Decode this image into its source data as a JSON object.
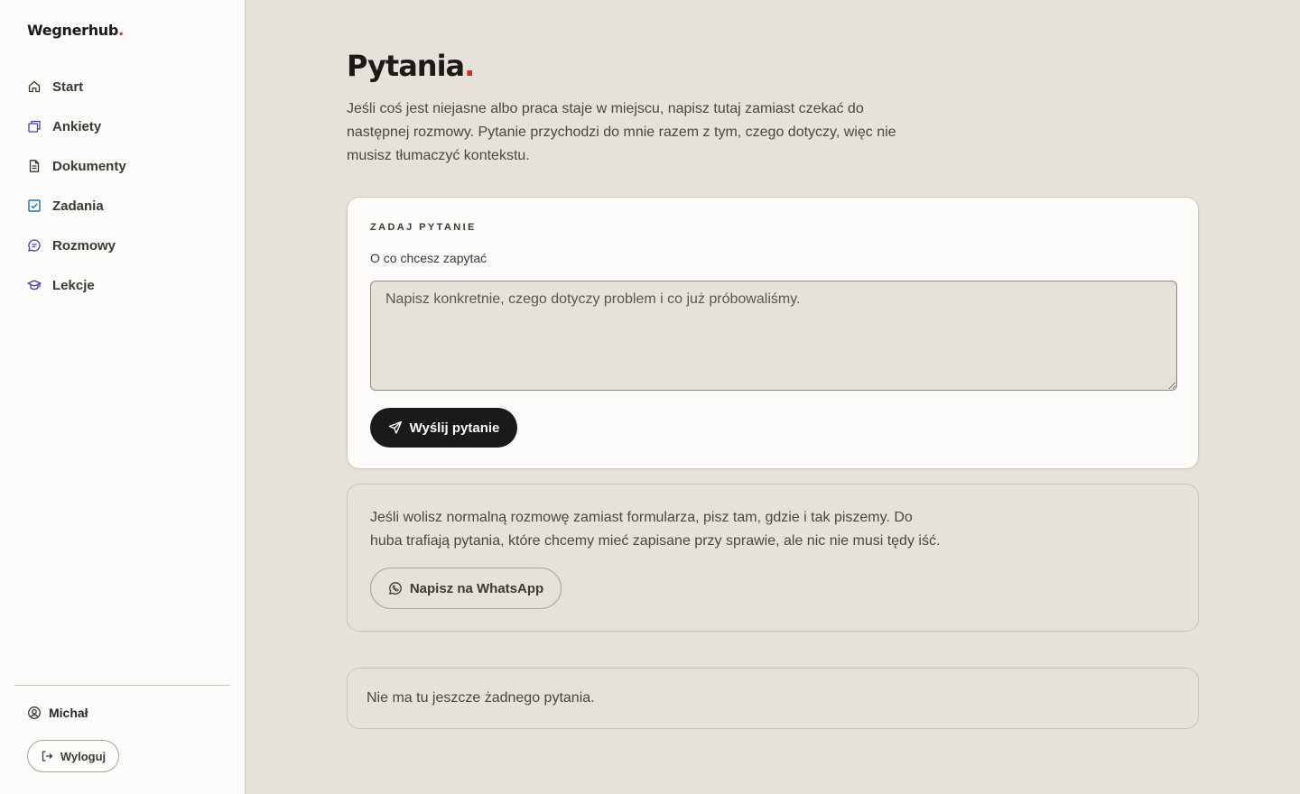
{
  "app": {
    "brand": "Wegnerhub",
    "brand_dot": "."
  },
  "colors": {
    "accent": "#c0381f",
    "nav_icon": "#4a3f9e",
    "nav_icon_check": "#1e6fa8",
    "background": "#e7e2d9",
    "sidebar": "#fdfcfa",
    "primary_button": "#1c1a18"
  },
  "sidebar": {
    "items": [
      {
        "label": "Start",
        "icon": "home-icon"
      },
      {
        "label": "Ankiety",
        "icon": "stack-icon"
      },
      {
        "label": "Dokumenty",
        "icon": "document-icon"
      },
      {
        "label": "Zadania",
        "icon": "checkbox-icon"
      },
      {
        "label": "Rozmowy",
        "icon": "chat-icon"
      },
      {
        "label": "Lekcje",
        "icon": "graduation-cap-icon"
      }
    ],
    "user": {
      "name": "Michał",
      "icon": "user-circle-icon"
    },
    "logout_label": "Wyloguj"
  },
  "main": {
    "title": "Pytania",
    "title_dot": ".",
    "intro": "Jeśli coś jest niejasne albo praca staje w miejscu, napisz tutaj zamiast czekać do następnej rozmowy. Pytanie przychodzi do mnie razem z tym, czego dotyczy, więc nie musisz tłumaczyć kontekstu.",
    "form": {
      "section_label": "ZADAJ PYTANIE",
      "field_label": "O co chcesz zapytać",
      "placeholder": "Napisz konkretnie, czego dotyczy problem i co już próbowaliśmy.",
      "value": "",
      "submit_label": "Wyślij pytanie"
    },
    "alternative": {
      "text": "Jeśli wolisz normalną rozmowę zamiast formularza, pisz tam, gdzie i tak piszemy. Do huba trafiają pytania, które chcemy mieć zapisane przy sprawie, ale nic nie musi tędy iść.",
      "whatsapp_label": "Napisz na WhatsApp"
    },
    "empty_state": "Nie ma tu jeszcze żadnego pytania."
  }
}
